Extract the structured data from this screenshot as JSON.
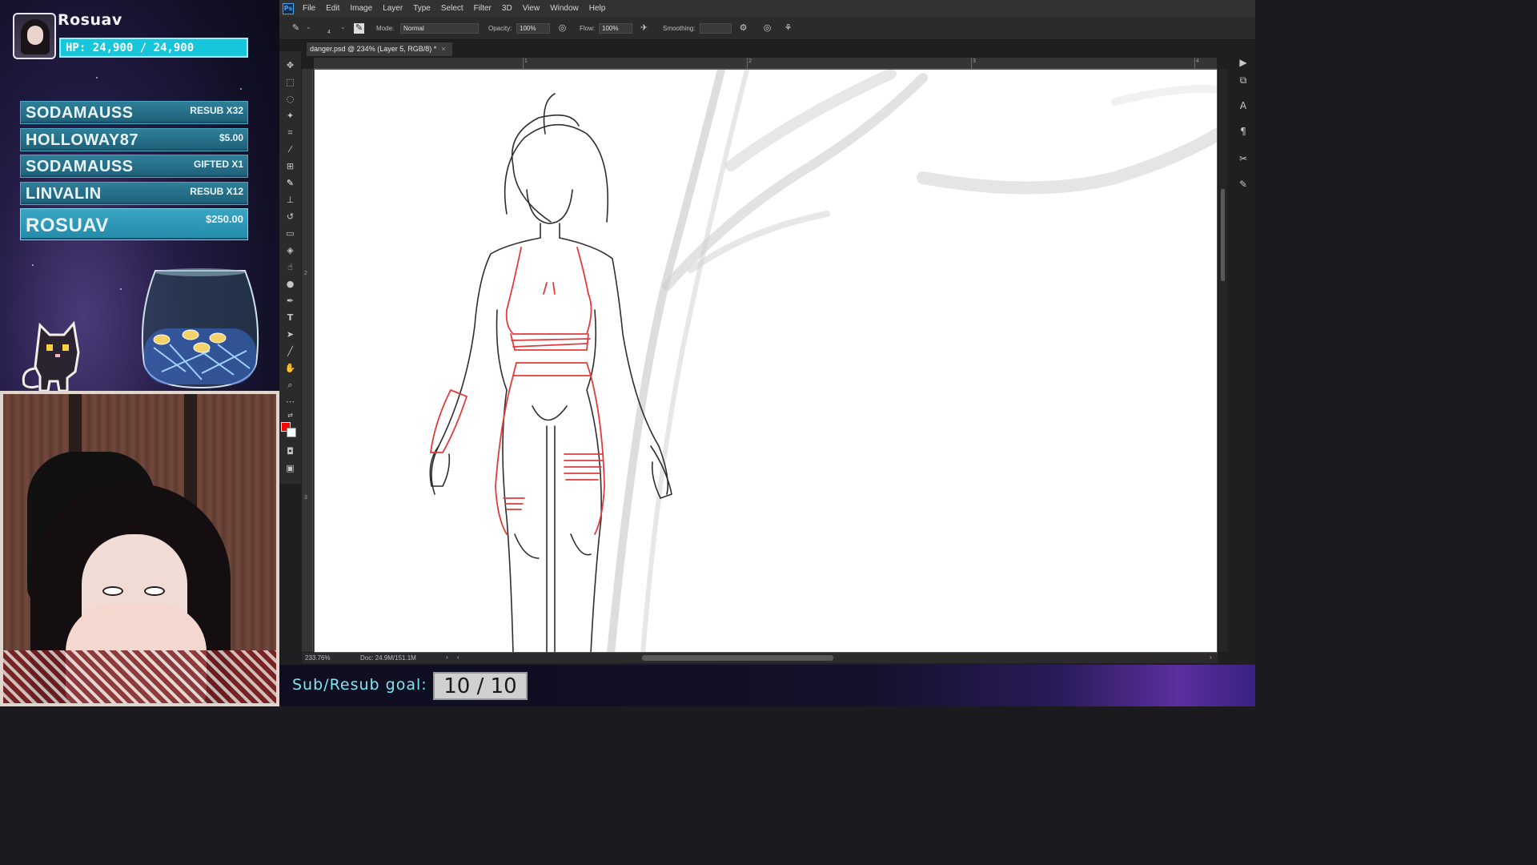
{
  "overlay": {
    "streamer_name": "Rosuav",
    "hp_text": "HP: 24,900 / 24,900",
    "events": [
      {
        "name": "SODAMAUSS",
        "detail": "RESUB X32"
      },
      {
        "name": "HOLLOWAY87",
        "detail": "$5.00"
      },
      {
        "name": "SODAMAUSS",
        "detail": "GIFTED X1"
      },
      {
        "name": "LINVALIN",
        "detail": "RESUB X12"
      },
      {
        "name": "ROSUAV",
        "detail": "$250.00"
      }
    ],
    "goal_label": "Sub/Resub goal:",
    "goal_value": "10 / 10"
  },
  "photoshop": {
    "menu": [
      "File",
      "Edit",
      "Image",
      "Layer",
      "Type",
      "Select",
      "Filter",
      "3D",
      "View",
      "Window",
      "Help"
    ],
    "options": {
      "brush_size": "4",
      "mode_label": "Mode:",
      "mode_value": "Normal",
      "opacity_label": "Opacity:",
      "opacity_value": "100%",
      "flow_label": "Flow:",
      "flow_value": "100%",
      "smoothing_label": "Smoothing:"
    },
    "doc_tab": "danger.psd @ 234% (Layer 5, RGB/8) *",
    "doc_tab_close": "×",
    "ruler_top_labels": [
      "1",
      "2",
      "3",
      "4"
    ],
    "ruler_left_labels": [
      "2",
      "3"
    ],
    "status": {
      "zoom": "233.76%",
      "doc": "Doc: 24.9M/151.1M"
    },
    "colors": {
      "foreground": "#ff0000",
      "background": "#ffffff",
      "accent": "#17c6da"
    },
    "tools": [
      "move-icon",
      "marquee-icon",
      "lasso-icon",
      "magic-wand-icon",
      "crop-icon",
      "eyedropper-icon",
      "patch-icon",
      "brush-icon",
      "stamp-icon",
      "history-brush-icon",
      "eraser-icon",
      "paint-bucket-icon",
      "smudge-icon",
      "dodge-icon",
      "pen-icon",
      "type-icon",
      "path-select-icon",
      "line-icon",
      "hand-icon",
      "zoom-icon",
      "more-icon"
    ]
  }
}
